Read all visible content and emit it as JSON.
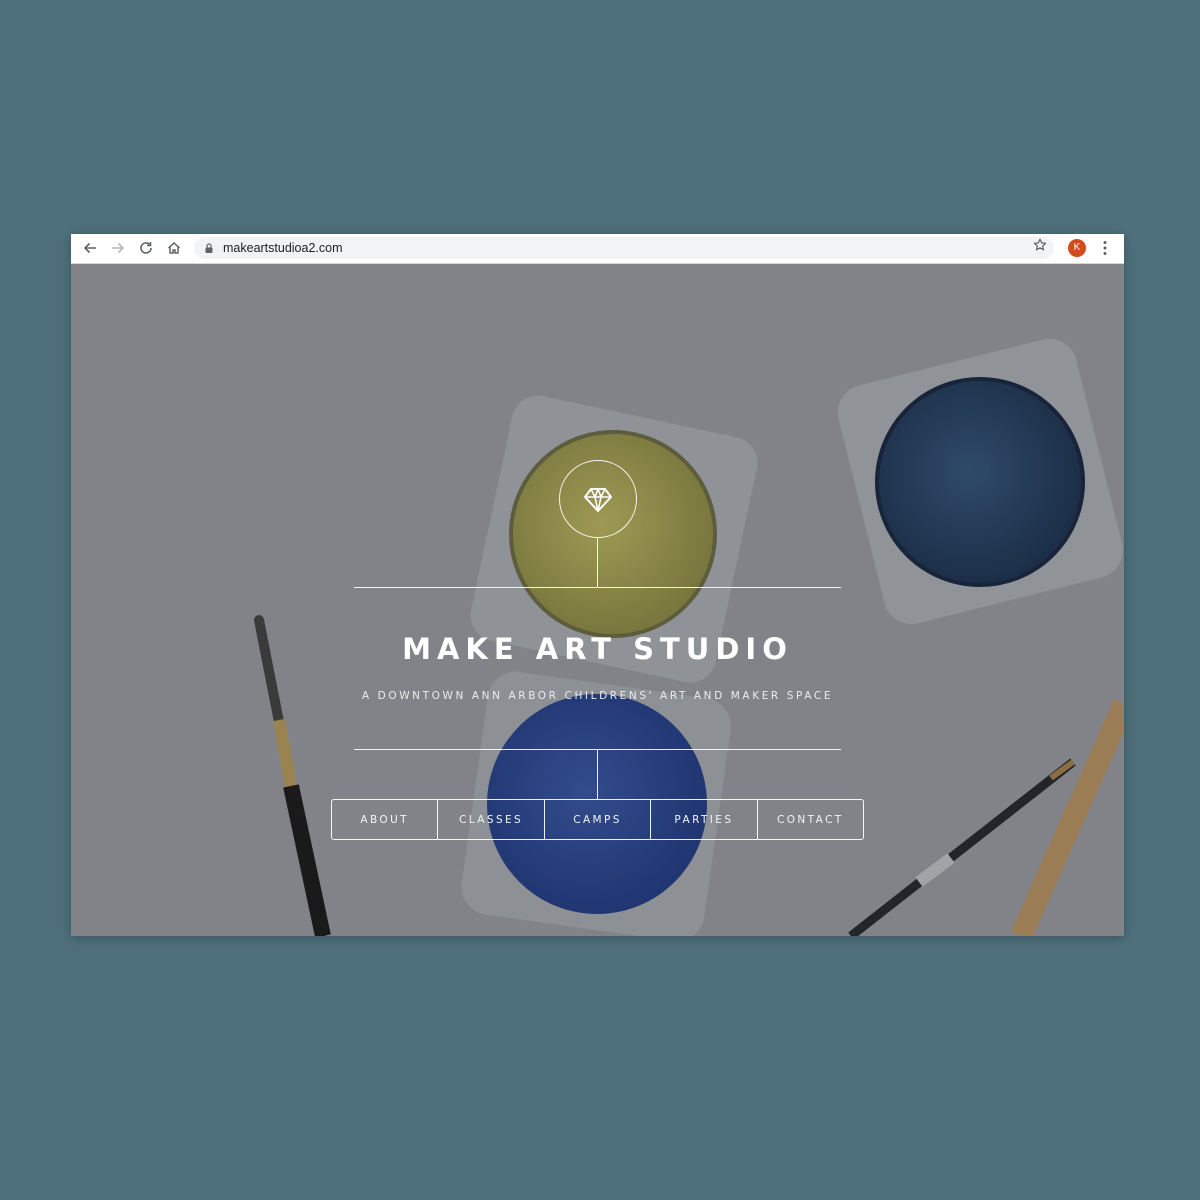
{
  "browser": {
    "url": "makeartstudioa2.com",
    "profile_initial": "K",
    "icons": [
      "back-arrow-icon",
      "forward-arrow-icon",
      "reload-icon",
      "home-icon",
      "lock-icon",
      "star-icon",
      "kebab-menu-icon"
    ]
  },
  "site": {
    "title": "MAKE ART STUDIO",
    "tagline": "A DOWNTOWN ANN ARBOR CHILDRENS' ART AND MAKER SPACE",
    "logo_icon": "diamond-icon"
  },
  "nav": {
    "items": [
      {
        "label": "ABOUT"
      },
      {
        "label": "CLASSES"
      },
      {
        "label": "CAMPS"
      },
      {
        "label": "PARTIES"
      },
      {
        "label": "CONTACT"
      }
    ]
  },
  "colors": {
    "page_background": "#4e6f7c",
    "avatar": "#d24a1e",
    "hero_overlay": "#828389"
  }
}
